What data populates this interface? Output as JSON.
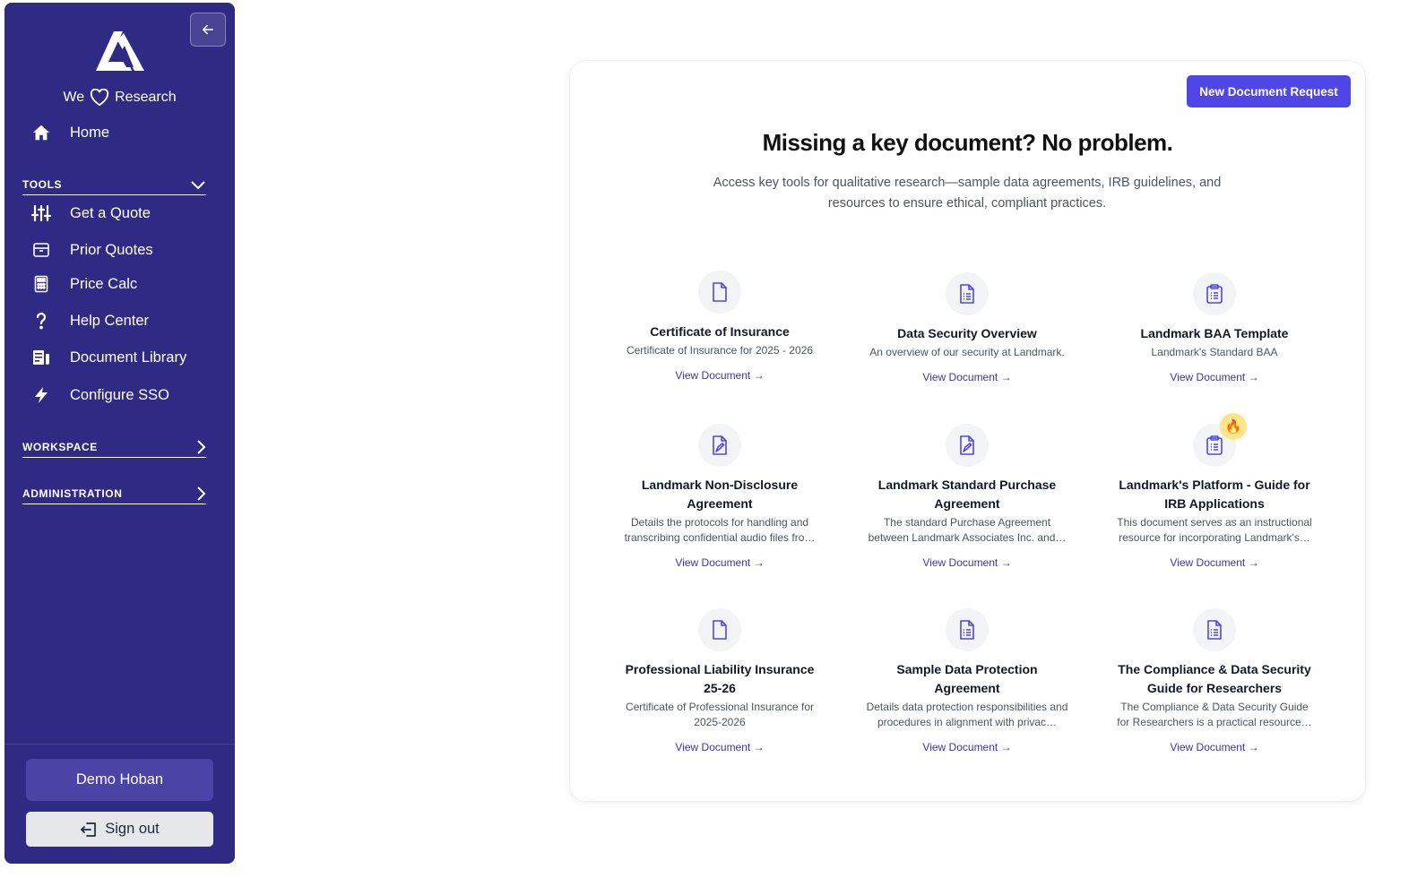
{
  "sidebar": {
    "tagline": {
      "left": "We",
      "right": "Research"
    },
    "home": {
      "label": "Home",
      "icon": "home-icon"
    },
    "sections": {
      "tools": "TOOLS",
      "workspace": "WORKSPACE",
      "administration": "ADMINISTRATION"
    },
    "tools": [
      {
        "label": "Get a Quote",
        "icon": "sliders-icon"
      },
      {
        "label": "Prior Quotes",
        "icon": "inbox-icon"
      },
      {
        "label": "Price Calc",
        "icon": "calculator-icon"
      },
      {
        "label": "Help Center",
        "icon": "question-icon"
      },
      {
        "label": "Document Library",
        "icon": "document-library-icon"
      },
      {
        "label": "Configure SSO",
        "icon": "bolt-icon"
      }
    ],
    "user_name": "Demo Hoban",
    "sign_out": "Sign out",
    "colors": {
      "background": "#2f2b85",
      "user_button": "#4a44a6"
    }
  },
  "main": {
    "new_document_button": "New Document Request",
    "headline": "Missing a key document? No problem.",
    "subhead": "Access key tools for qualitative research—sample data agreements, IRB guidelines, and resources to ensure ethical, compliant practices.",
    "link_label": "View Document →",
    "accent_color": "#4f46e5",
    "documents": [
      {
        "title": "Certificate of Insurance",
        "description": "Certificate of Insurance for 2025 - 2026",
        "icon": "document-icon"
      },
      {
        "title": "Data Security Overview",
        "description": "An overview of our security at Landmark.",
        "icon": "document-list-icon"
      },
      {
        "title": "Landmark BAA Template",
        "description": "Landmark's Standard BAA",
        "icon": "clipboard-list-icon"
      },
      {
        "title": "Landmark Non-Disclosure Agreement",
        "description": "Details the protocols for handling and transcribing confidential audio files fro…",
        "icon": "document-signature-icon"
      },
      {
        "title": "Landmark Standard Purchase Agreement",
        "description": "The standard Purchase Agreement between Landmark Associates Inc. and…",
        "icon": "document-signature-icon"
      },
      {
        "title": "Landmark's Platform - Guide for IRB Applications",
        "description": "This document serves as an instructional resource for incorporating Landmark's…",
        "icon": "clipboard-list-icon",
        "badge": "🔥"
      },
      {
        "title": "Professional Liability Insurance 25-26",
        "description": "Certificate of Professional Insurance for 2025-2026",
        "icon": "document-icon"
      },
      {
        "title": "Sample Data Protection Agreement",
        "description": "Details data protection responsibilities and procedures in alignment with privac…",
        "icon": "document-list-icon"
      },
      {
        "title": "The Compliance & Data Security Guide for Researchers",
        "description": "The Compliance & Data Security Guide for Researchers is a practical resource…",
        "icon": "document-list-icon"
      }
    ]
  }
}
